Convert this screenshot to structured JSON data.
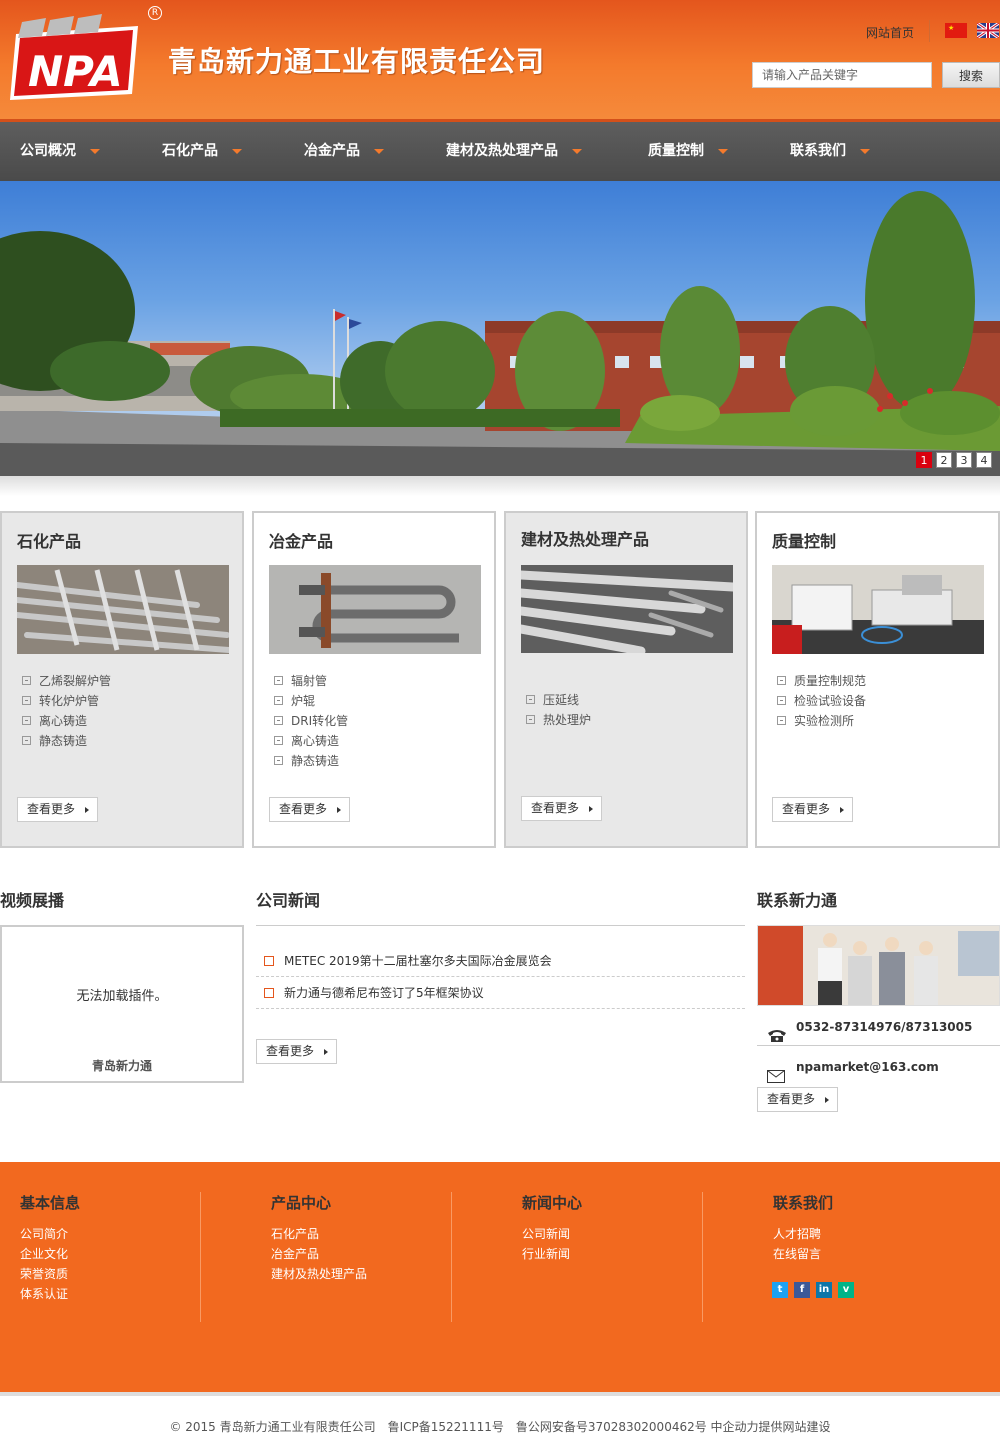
{
  "header": {
    "logo_text": "NPA",
    "company_name": "青岛新力通工业有限责任公司",
    "home_link": "网站首页",
    "search_placeholder": "请输入产品关键字",
    "search_button": "搜索"
  },
  "nav": {
    "items": [
      {
        "label": "公司概况"
      },
      {
        "label": "石化产品"
      },
      {
        "label": "冶金产品"
      },
      {
        "label": "建材及热处理产品"
      },
      {
        "label": "质量控制"
      },
      {
        "label": "联系我们"
      }
    ]
  },
  "banner": {
    "slides": [
      "1",
      "2",
      "3",
      "4"
    ],
    "active_slide": "1"
  },
  "cards": [
    {
      "title": "石化产品",
      "items": [
        "乙烯裂解炉管",
        "转化炉炉管",
        "离心铸造",
        "静态铸造"
      ],
      "more": "查看更多"
    },
    {
      "title": "冶金产品",
      "items": [
        "辐射管",
        "炉辊",
        "DRI转化管",
        "离心铸造",
        "静态铸造"
      ],
      "more": "查看更多"
    },
    {
      "title": "建材及热处理产品",
      "items": [
        "压延线",
        "热处理炉"
      ],
      "more": "查看更多"
    },
    {
      "title": "质量控制",
      "items": [
        "质量控制规范",
        "检验试验设备",
        "实验检测所"
      ],
      "more": "查看更多"
    }
  ],
  "video": {
    "title": "视频展播",
    "message": "无法加载插件。",
    "caption": "青岛新力通"
  },
  "news": {
    "title": "公司新闻",
    "items": [
      "METEC 2019第十二届杜塞尔多夫国际冶金展览会",
      "新力通与德希尼布签订了5年框架协议"
    ],
    "more": "查看更多"
  },
  "contact": {
    "title": "联系新力通",
    "phone": "0532-87314976/87313005",
    "email": "npamarket@163.com",
    "more": "查看更多"
  },
  "footer": {
    "columns": [
      {
        "title": "基本信息",
        "links": [
          "公司简介",
          "企业文化",
          "荣誉资质",
          "体系认证"
        ]
      },
      {
        "title": "产品中心",
        "links": [
          "石化产品",
          "冶金产品",
          "建材及热处理产品"
        ]
      },
      {
        "title": "新闻中心",
        "links": [
          "公司新闻",
          "行业新闻"
        ]
      },
      {
        "title": "联系我们",
        "links": [
          "人才招聘",
          "在线留言"
        ]
      }
    ],
    "social_icons": [
      "twitter-icon",
      "facebook-icon",
      "linkedin-icon",
      "vine-icon"
    ],
    "copyright": "© 2015 青岛新力通工业有限责任公司　鲁ICP备15221111号　鲁公网安备号37028302000462号 中企动力提供网站建设"
  },
  "colors": {
    "brand_orange": "#f2691f",
    "nav_gray": "#555555",
    "active_dot": "#d9000f"
  }
}
